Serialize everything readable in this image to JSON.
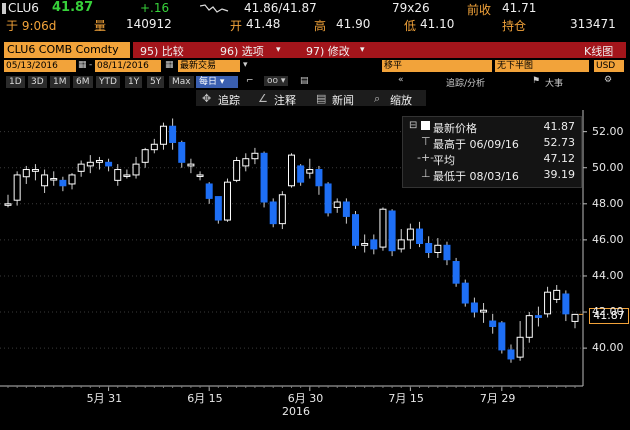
{
  "header": {
    "ticker": "CLU6",
    "last": "41.87",
    "change": "+.16",
    "bid_ask": "41.86/41.87",
    "size": "79x26",
    "prev_close_label": "前收",
    "prev_close": "41.71",
    "time_label": "于 9:06d",
    "volume_label": "量",
    "volume": "140912",
    "open_label": "开",
    "open": "41.48",
    "high_label": "高",
    "high": "41.90",
    "low_label": "低",
    "low": "41.10",
    "oi_label": "持仓",
    "oi": "313471"
  },
  "toolbar": {
    "security": "CLU6 COMB Comdty",
    "compare": "95) 比较",
    "options": "96) 选项",
    "edit": "97) 修改",
    "chart_type": "K线图"
  },
  "controls": {
    "start_date": "05/13/2016",
    "end_date": "08/11/2016",
    "mode": "最新交易",
    "period": "每日",
    "move": "移平",
    "none": "无下半图",
    "currency": "USD",
    "range_buttons": [
      "1D",
      "3D",
      "1M",
      "6M",
      "YTD",
      "1Y",
      "5Y",
      "Max"
    ],
    "track_label": "追踪/分析",
    "big_label": "大事"
  },
  "tools": {
    "track": "追踪",
    "annotate": "注释",
    "news": "新闻",
    "zoom": "缩放"
  },
  "legend": {
    "items": [
      {
        "label": "最新价格",
        "value": "41.87"
      },
      {
        "label": "最高于 06/09/16",
        "value": "52.73"
      },
      {
        "label": "平均",
        "value": "47.12"
      },
      {
        "label": "最低于 08/03/16",
        "value": "39.19"
      }
    ]
  },
  "current_price_tag": "41.87",
  "chart_data": {
    "type": "candlestick",
    "yticks": [
      "52.00",
      "50.00",
      "48.00",
      "46.00",
      "44.00",
      "42.00",
      "40.00"
    ],
    "ylim": [
      37.9,
      53.2
    ],
    "xticks": [
      "5月 31",
      "6月 15",
      "6月 30",
      "7月 15",
      "7月 29"
    ],
    "xlabel_year": "2016",
    "candles": [
      {
        "o": 48.0,
        "c": 48.0,
        "h": 48.5,
        "l": 47.8
      },
      {
        "o": 48.2,
        "c": 49.6,
        "h": 49.8,
        "l": 47.9
      },
      {
        "o": 49.5,
        "c": 49.9,
        "h": 50.1,
        "l": 49.1
      },
      {
        "o": 49.8,
        "c": 49.9,
        "h": 50.2,
        "l": 49.3
      },
      {
        "o": 49.0,
        "c": 49.6,
        "h": 49.9,
        "l": 48.6
      },
      {
        "o": 49.4,
        "c": 49.4,
        "h": 49.8,
        "l": 49.0
      },
      {
        "o": 49.3,
        "c": 49.0,
        "h": 49.5,
        "l": 48.7
      },
      {
        "o": 49.1,
        "c": 49.6,
        "h": 49.7,
        "l": 48.8
      },
      {
        "o": 49.8,
        "c": 50.2,
        "h": 50.4,
        "l": 49.5
      },
      {
        "o": 50.1,
        "c": 50.3,
        "h": 50.7,
        "l": 49.7
      },
      {
        "o": 50.3,
        "c": 50.4,
        "h": 50.6,
        "l": 49.9
      },
      {
        "o": 50.3,
        "c": 50.1,
        "h": 50.5,
        "l": 49.8
      },
      {
        "o": 49.3,
        "c": 49.9,
        "h": 50.2,
        "l": 49.0
      },
      {
        "o": 49.6,
        "c": 49.6,
        "h": 49.9,
        "l": 49.4
      },
      {
        "o": 49.6,
        "c": 50.2,
        "h": 50.6,
        "l": 49.4
      },
      {
        "o": 50.3,
        "c": 51.0,
        "h": 51.1,
        "l": 50.0
      },
      {
        "o": 51.0,
        "c": 51.3,
        "h": 51.6,
        "l": 50.8
      },
      {
        "o": 51.3,
        "c": 52.3,
        "h": 52.5,
        "l": 51.0
      },
      {
        "o": 52.3,
        "c": 51.4,
        "h": 52.73,
        "l": 51.0
      },
      {
        "o": 51.4,
        "c": 50.3,
        "h": 51.5,
        "l": 50.0
      },
      {
        "o": 50.1,
        "c": 50.2,
        "h": 50.5,
        "l": 49.7
      },
      {
        "o": 49.6,
        "c": 49.6,
        "h": 49.8,
        "l": 49.3
      },
      {
        "o": 49.1,
        "c": 48.3,
        "h": 49.2,
        "l": 48.0
      },
      {
        "o": 48.4,
        "c": 47.1,
        "h": 48.4,
        "l": 46.9
      },
      {
        "o": 47.1,
        "c": 49.2,
        "h": 49.4,
        "l": 47.0
      },
      {
        "o": 49.3,
        "c": 50.4,
        "h": 50.6,
        "l": 49.2
      },
      {
        "o": 50.1,
        "c": 50.5,
        "h": 50.8,
        "l": 49.8
      },
      {
        "o": 50.5,
        "c": 50.8,
        "h": 51.1,
        "l": 50.2
      },
      {
        "o": 50.8,
        "c": 48.1,
        "h": 50.9,
        "l": 47.8
      },
      {
        "o": 48.1,
        "c": 46.9,
        "h": 48.3,
        "l": 46.7
      },
      {
        "o": 46.9,
        "c": 48.5,
        "h": 48.7,
        "l": 46.6
      },
      {
        "o": 49.0,
        "c": 50.7,
        "h": 50.8,
        "l": 48.9
      },
      {
        "o": 50.1,
        "c": 49.2,
        "h": 50.2,
        "l": 49.0
      },
      {
        "o": 49.7,
        "c": 49.9,
        "h": 50.5,
        "l": 49.4
      },
      {
        "o": 49.9,
        "c": 49.0,
        "h": 50.1,
        "l": 48.5
      },
      {
        "o": 49.1,
        "c": 47.5,
        "h": 49.2,
        "l": 47.3
      },
      {
        "o": 47.8,
        "c": 48.1,
        "h": 48.3,
        "l": 47.5
      },
      {
        "o": 48.1,
        "c": 47.3,
        "h": 48.3,
        "l": 46.9
      },
      {
        "o": 47.4,
        "c": 45.7,
        "h": 47.6,
        "l": 45.5
      },
      {
        "o": 45.7,
        "c": 45.8,
        "h": 46.3,
        "l": 45.3
      },
      {
        "o": 46.0,
        "c": 45.5,
        "h": 46.3,
        "l": 45.2
      },
      {
        "o": 45.6,
        "c": 47.7,
        "h": 47.8,
        "l": 45.4
      },
      {
        "o": 47.6,
        "c": 45.4,
        "h": 47.7,
        "l": 45.1
      },
      {
        "o": 45.5,
        "c": 46.0,
        "h": 46.6,
        "l": 45.3
      },
      {
        "o": 46.0,
        "c": 46.6,
        "h": 46.9,
        "l": 45.5
      },
      {
        "o": 46.6,
        "c": 45.8,
        "h": 47.0,
        "l": 45.6
      },
      {
        "o": 45.8,
        "c": 45.3,
        "h": 46.2,
        "l": 45.0
      },
      {
        "o": 45.3,
        "c": 45.7,
        "h": 46.1,
        "l": 45.0
      },
      {
        "o": 45.7,
        "c": 44.9,
        "h": 45.9,
        "l": 44.6
      },
      {
        "o": 44.8,
        "c": 43.6,
        "h": 45.0,
        "l": 43.4
      },
      {
        "o": 43.6,
        "c": 42.5,
        "h": 43.8,
        "l": 42.3
      },
      {
        "o": 42.5,
        "c": 42.0,
        "h": 42.8,
        "l": 41.7
      },
      {
        "o": 42.0,
        "c": 42.1,
        "h": 42.5,
        "l": 41.4
      },
      {
        "o": 41.5,
        "c": 41.2,
        "h": 41.9,
        "l": 40.8
      },
      {
        "o": 41.4,
        "c": 39.9,
        "h": 41.5,
        "l": 39.7
      },
      {
        "o": 39.9,
        "c": 39.4,
        "h": 40.2,
        "l": 39.19
      },
      {
        "o": 39.5,
        "c": 40.6,
        "h": 41.5,
        "l": 39.3
      },
      {
        "o": 40.6,
        "c": 41.8,
        "h": 42.0,
        "l": 40.3
      },
      {
        "o": 41.8,
        "c": 41.7,
        "h": 42.3,
        "l": 41.2
      },
      {
        "o": 41.9,
        "c": 43.1,
        "h": 43.4,
        "l": 41.7
      },
      {
        "o": 42.7,
        "c": 43.2,
        "h": 43.5,
        "l": 42.5
      },
      {
        "o": 43.0,
        "c": 41.9,
        "h": 43.2,
        "l": 41.5
      },
      {
        "o": 41.48,
        "c": 41.87,
        "h": 41.9,
        "l": 41.1
      }
    ]
  },
  "colors": {
    "up": "#ffffff",
    "down": "#1e6ff5",
    "accent": "#f2a33a",
    "toolbar_red": "#a3151b",
    "current_tag_border": "#f2a33a"
  }
}
